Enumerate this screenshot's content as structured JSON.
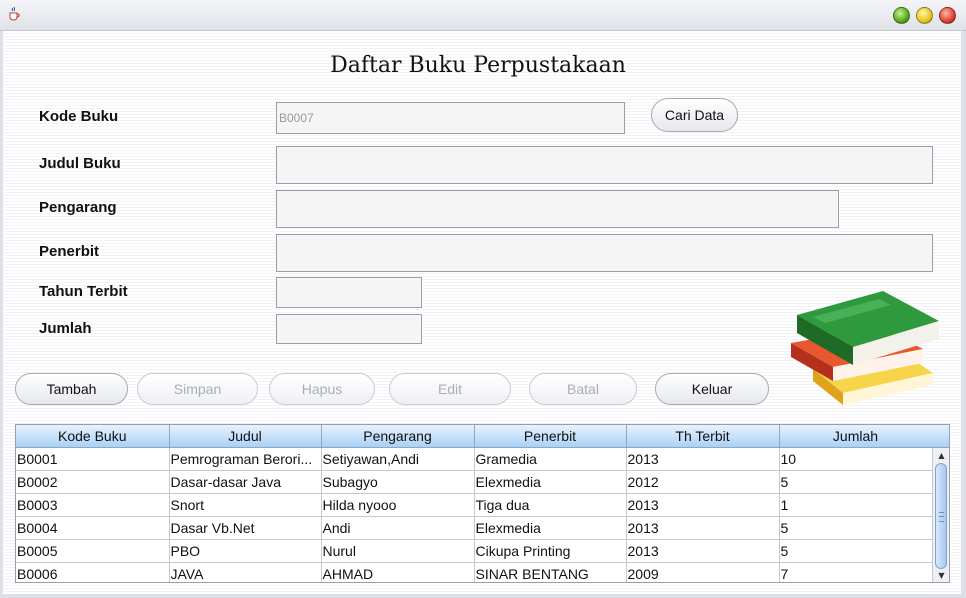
{
  "window": {
    "icon": "java-cup-icon"
  },
  "form": {
    "title": "Daftar Buku Perpustakaan",
    "labels": {
      "kode": "Kode Buku",
      "judul": "Judul Buku",
      "pengarang": "Pengarang",
      "penerbit": "Penerbit",
      "tahun": "Tahun Terbit",
      "jumlah": "Jumlah"
    },
    "values": {
      "kode": "B0007",
      "judul": "",
      "pengarang": "",
      "penerbit": "",
      "tahun": "",
      "jumlah": ""
    },
    "search_button": "Cari Data"
  },
  "buttons": {
    "tambah": "Tambah",
    "simpan": "Simpan",
    "hapus": "Hapus",
    "edit": "Edit",
    "batal": "Batal",
    "keluar": "Keluar"
  },
  "table": {
    "headers": [
      "Kode Buku",
      "Judul",
      "Pengarang",
      "Penerbit",
      "Th Terbit",
      "Jumlah"
    ],
    "rows": [
      [
        "B0001",
        "Pemrograman Berori...",
        "Setiyawan,Andi",
        "Gramedia",
        "2013",
        "10"
      ],
      [
        "B0002",
        "Dasar-dasar Java",
        "Subagyo",
        "Elexmedia",
        "2012",
        "5"
      ],
      [
        "B0003",
        "Snort",
        "Hilda nyooo",
        "Tiga dua",
        "2013",
        "1"
      ],
      [
        "B0004",
        "Dasar Vb.Net",
        "Andi",
        "Elexmedia",
        "2013",
        "5"
      ],
      [
        "B0005",
        "PBO",
        "Nurul",
        "Cikupa Printing",
        "2013",
        "5"
      ],
      [
        "B0006",
        "JAVA",
        "AHMAD",
        "SINAR BENTANG",
        "2009",
        "7"
      ]
    ]
  },
  "colors": {
    "header_gradient_top": "#e7f2ff",
    "header_gradient_bottom": "#a9d1f5",
    "disabled_text": "#a9adb5"
  }
}
